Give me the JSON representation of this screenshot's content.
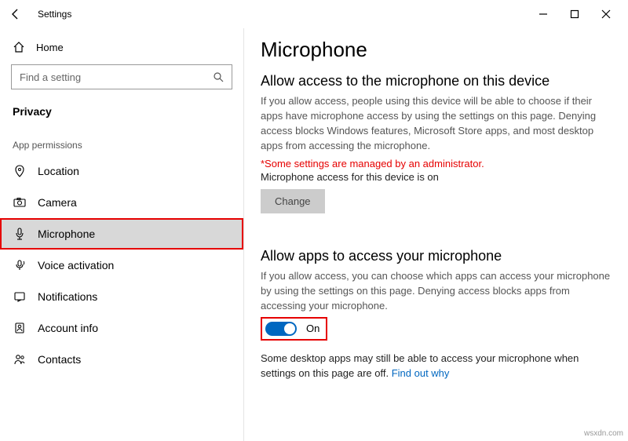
{
  "app": {
    "title": "Settings"
  },
  "sidebar": {
    "home": "Home",
    "search_placeholder": "Find a setting",
    "category": "Privacy",
    "section_label": "App permissions",
    "items": [
      {
        "label": "Location"
      },
      {
        "label": "Camera"
      },
      {
        "label": "Microphone"
      },
      {
        "label": "Voice activation"
      },
      {
        "label": "Notifications"
      },
      {
        "label": "Account info"
      },
      {
        "label": "Contacts"
      }
    ]
  },
  "main": {
    "title": "Microphone",
    "section1": {
      "heading": "Allow access to the microphone on this device",
      "body": "If you allow access, people using this device will be able to choose if their apps have microphone access by using the settings on this page. Denying access blocks Windows features, Microsoft Store apps, and most desktop apps from accessing the microphone.",
      "admin_notice": "*Some settings are managed by an administrator.",
      "access_status": "Microphone access for this device is on",
      "change_label": "Change"
    },
    "section2": {
      "heading": "Allow apps to access your microphone",
      "body": "If you allow access, you can choose which apps can access your microphone by using the settings on this page. Denying access blocks apps from accessing your microphone.",
      "toggle_label": "On",
      "note": "Some desktop apps may still be able to access your microphone when settings on this page are off. ",
      "link": "Find out why"
    }
  },
  "watermark": "wsxdn.com"
}
